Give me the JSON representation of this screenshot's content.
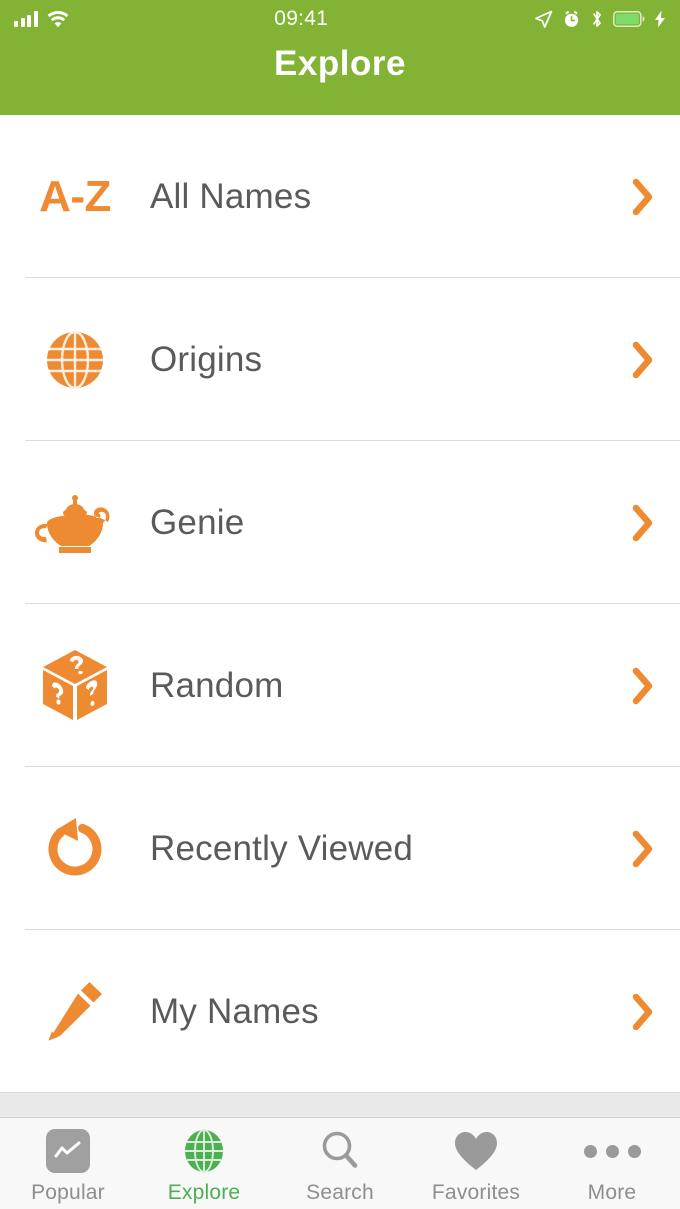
{
  "status_bar": {
    "time": "09:41",
    "signal_icon": "signal-bars-icon",
    "wifi_icon": "wifi-icon",
    "location_icon": "location-arrow-icon",
    "alarm_icon": "alarm-clock-icon",
    "bluetooth_icon": "bluetooth-icon",
    "battery_icon": "battery-icon",
    "charging_icon": "lightning-bolt-icon"
  },
  "header": {
    "title": "Explore",
    "background_color": "#82b335"
  },
  "colors": {
    "accent_orange": "#ee8b32",
    "header_green": "#82b335",
    "active_tab_green": "#4caf50",
    "label_gray": "#5a5a5a",
    "tab_gray": "#8e8e8e"
  },
  "list": {
    "rows": [
      {
        "label": "All Names",
        "icon": "a-z-text-icon",
        "icon_text": "A-Z",
        "chevron": "chevron-right-icon"
      },
      {
        "label": "Origins",
        "icon": "globe-icon",
        "icon_text": "",
        "chevron": "chevron-right-icon"
      },
      {
        "label": "Genie",
        "icon": "genie-lamp-icon",
        "icon_text": "",
        "chevron": "chevron-right-icon"
      },
      {
        "label": "Random",
        "icon": "question-dice-icon",
        "icon_text": "",
        "chevron": "chevron-right-icon"
      },
      {
        "label": "Recently Viewed",
        "icon": "history-arrow-icon",
        "icon_text": "",
        "chevron": "chevron-right-icon"
      },
      {
        "label": "My Names",
        "icon": "pencil-icon",
        "icon_text": "",
        "chevron": "chevron-right-icon"
      }
    ]
  },
  "tabbar": {
    "tabs": [
      {
        "label": "Popular",
        "icon": "chart-line-icon",
        "active": false
      },
      {
        "label": "Explore",
        "icon": "globe-icon",
        "active": true
      },
      {
        "label": "Search",
        "icon": "magnifier-icon",
        "active": false
      },
      {
        "label": "Favorites",
        "icon": "heart-icon",
        "active": false
      },
      {
        "label": "More",
        "icon": "ellipsis-icon",
        "active": false
      }
    ]
  }
}
